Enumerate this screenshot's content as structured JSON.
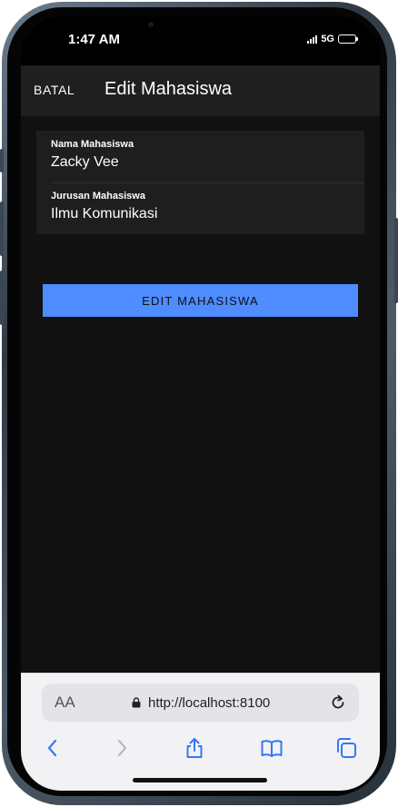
{
  "status_bar": {
    "time": "1:47 AM",
    "network": "5G"
  },
  "header": {
    "cancel_label": "BATAL",
    "title": "Edit Mahasiswa"
  },
  "form": {
    "fields": [
      {
        "label": "Nama Mahasiswa",
        "value": "Zacky Vee"
      },
      {
        "label": "Jurusan Mahasiswa",
        "value": "Ilmu Komunikasi"
      }
    ],
    "submit_label": "EDIT MAHASISWA"
  },
  "browser": {
    "text_size_label": "AA",
    "url": "http://localhost:8100"
  },
  "colors": {
    "accent": "#4e8cff",
    "background": "#111111",
    "header": "#1f1f1f"
  }
}
